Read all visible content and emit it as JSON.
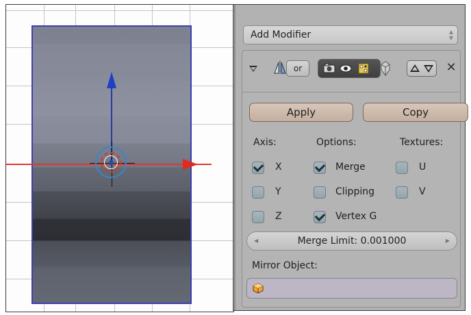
{
  "add_modifier": {
    "label": "Add Modifier",
    "icon": "updown-arrows-icon"
  },
  "modifier": {
    "header": {
      "collapse_icon": "triangle-down-icon",
      "type_icon": "mirror-modifier-icon",
      "name_toggle": "or",
      "visibility_icons": [
        "render-camera-icon",
        "viewport-eye-icon",
        "editmode-icon",
        "cage-icon"
      ],
      "move_icons": [
        "move-up-icon",
        "move-down-icon"
      ],
      "remove_icon": "close-icon"
    },
    "apply_label": "Apply",
    "copy_label": "Copy",
    "columns": {
      "axis": {
        "title": "Axis:",
        "items": [
          {
            "label": "X",
            "checked": true
          },
          {
            "label": "Y",
            "checked": false
          },
          {
            "label": "Z",
            "checked": false
          }
        ]
      },
      "options": {
        "title": "Options:",
        "items": [
          {
            "label": "Merge",
            "checked": true
          },
          {
            "label": "Clipping",
            "checked": false
          },
          {
            "label": "Vertex G",
            "checked": true
          }
        ]
      },
      "textures": {
        "title": "Textures:",
        "items": [
          {
            "label": "U",
            "checked": false
          },
          {
            "label": "V",
            "checked": false
          }
        ]
      }
    },
    "merge_limit_label": "Merge Limit: 0.001000",
    "mirror_object_label": "Mirror Object:",
    "mirror_object_value": ""
  },
  "colors": {
    "x_axis": "#e0372c",
    "y_axis": "#1f3fc4",
    "mesh_outline": "#3c3fb0",
    "apply_button": "#cfbcae",
    "panel_bg": "#b4b4b4"
  }
}
